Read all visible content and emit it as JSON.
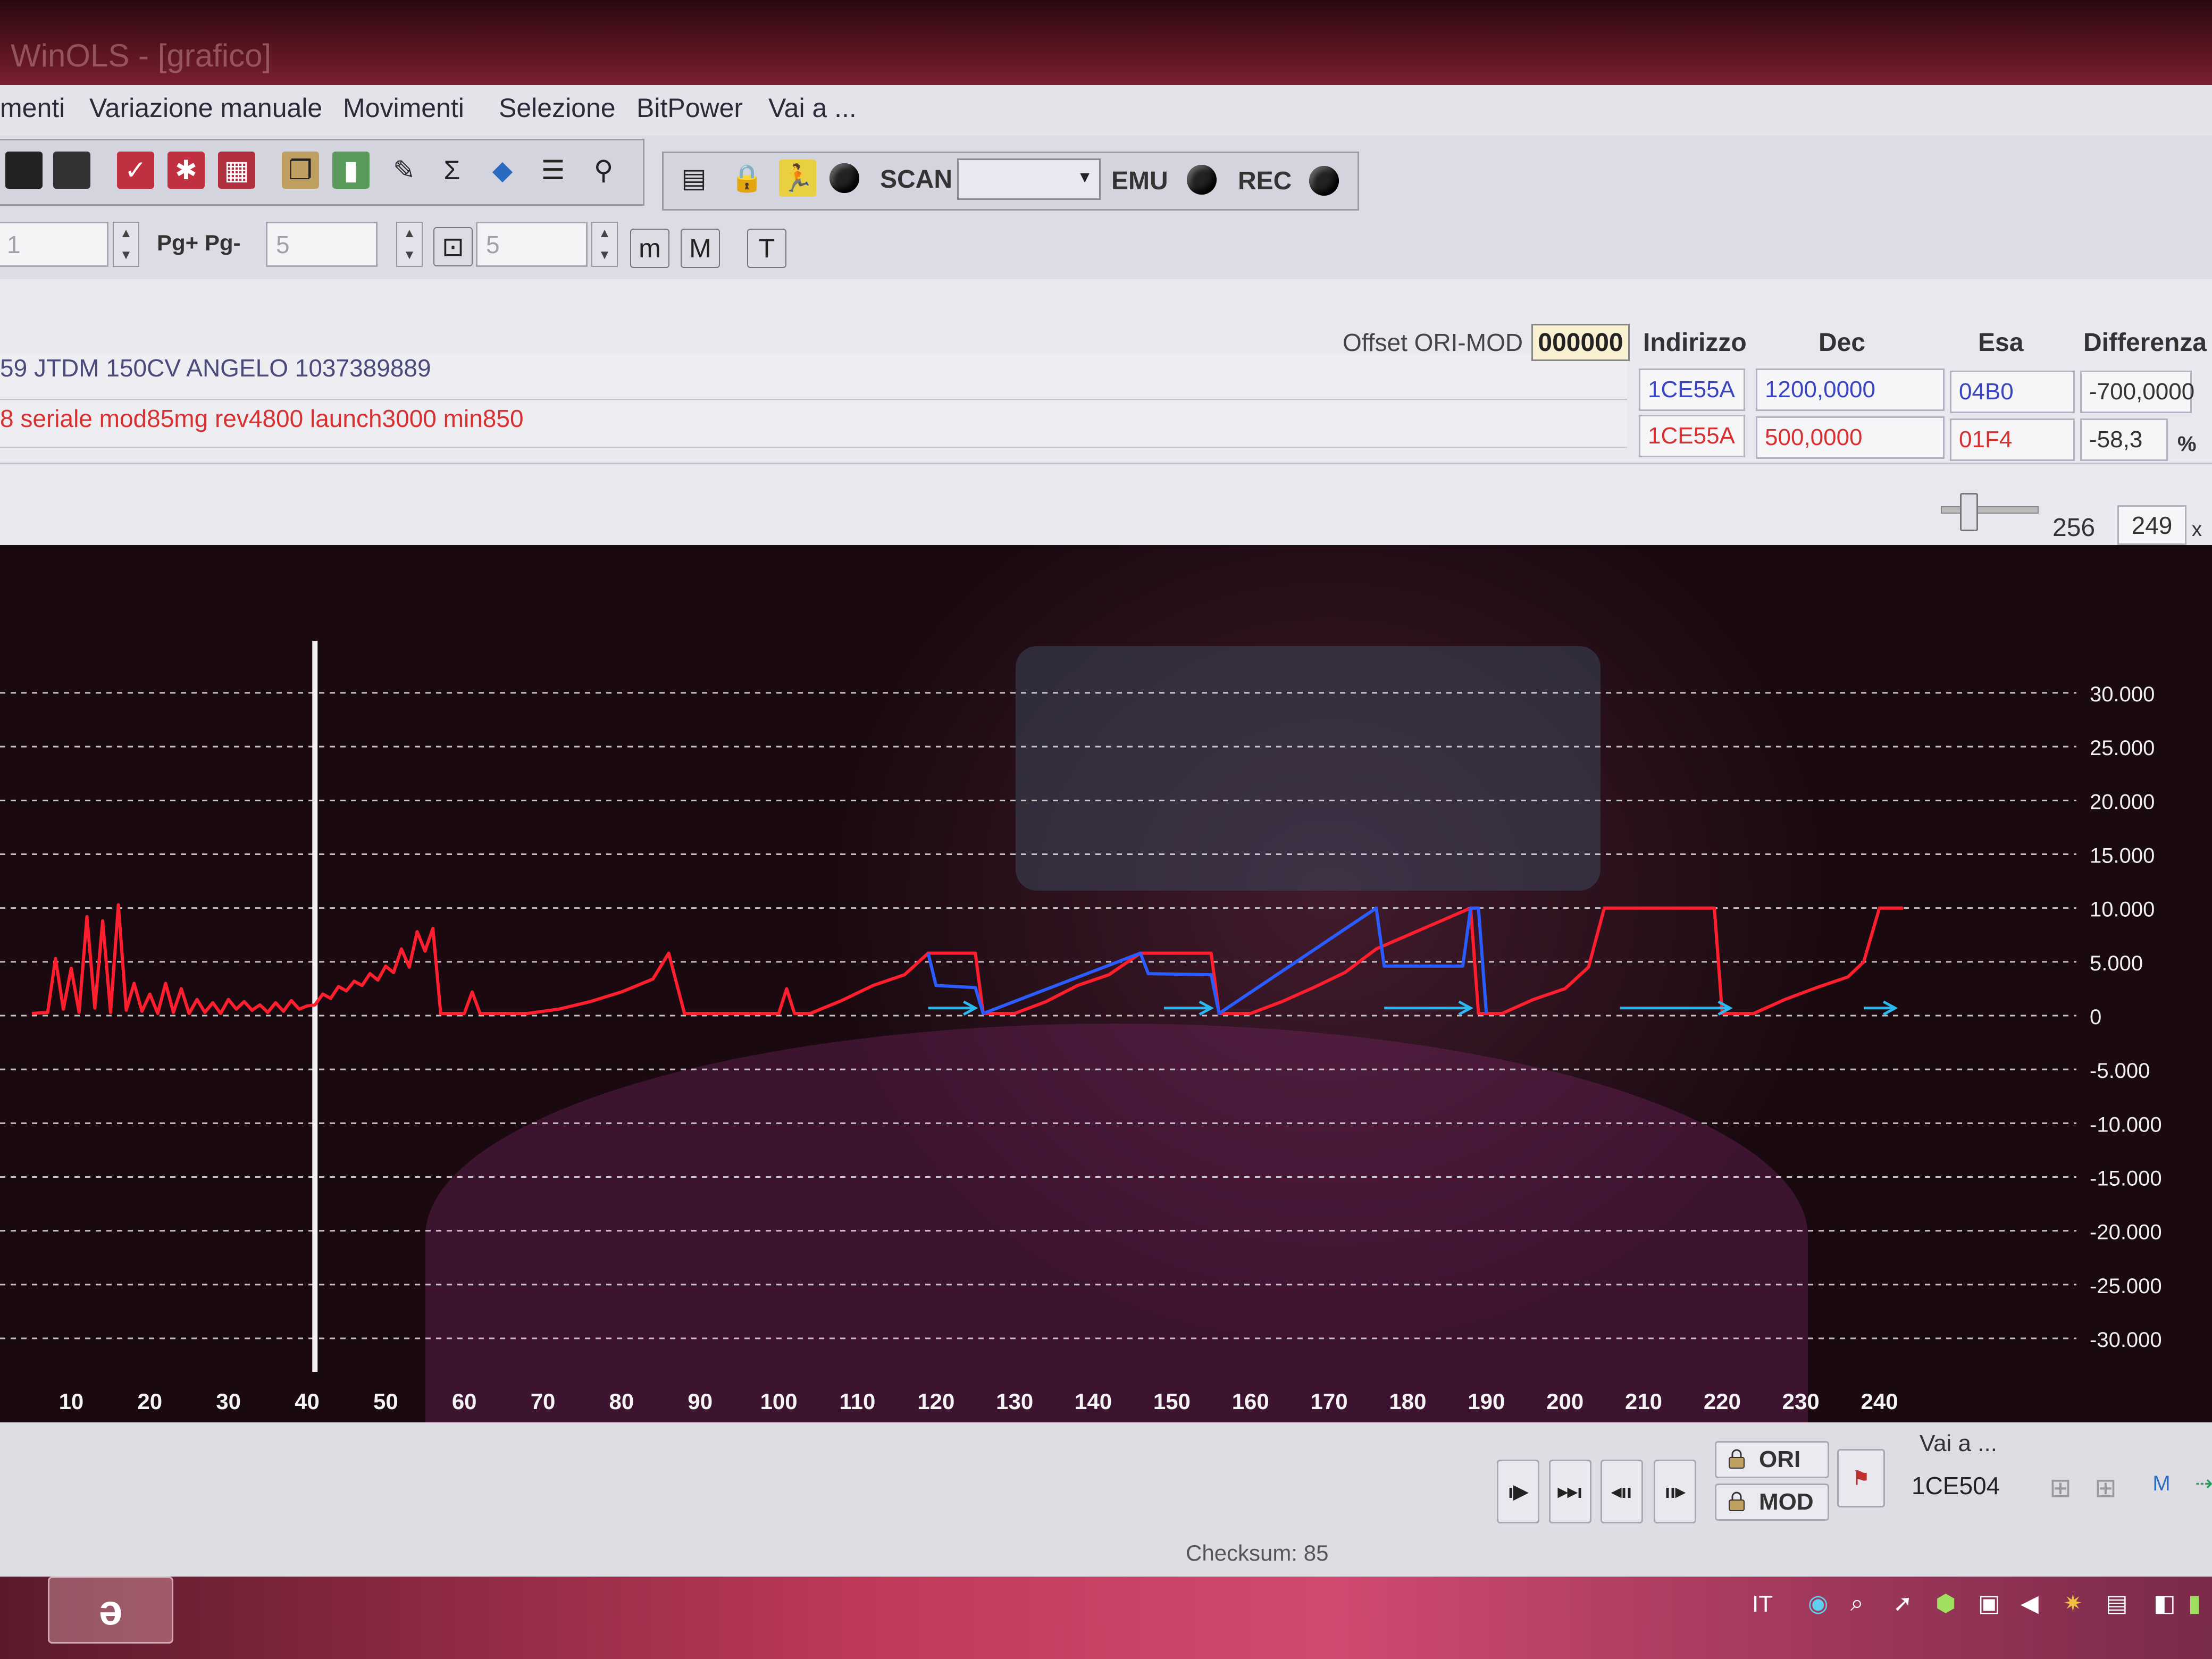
{
  "window": {
    "title": "WinOLS - [grafico]"
  },
  "menu": {
    "items": [
      "menti",
      "Variazione manuale",
      "Movimenti",
      "Selezione",
      "BitPower",
      "Vai a ..."
    ]
  },
  "toolbar": {
    "scan_label": "SCAN",
    "emu_label": "EMU",
    "rec_label": "REC",
    "scan_select_value": ""
  },
  "toolbar2": {
    "field1_value": "1",
    "pg_label": "Pg+ Pg-",
    "field2_value": "5",
    "field3_value": "5"
  },
  "info": {
    "ecu_name": "59 JTDM 150CV ANGELO 1037389889",
    "mod_name": "8 seriale mod85mg rev4800 launch3000 min850",
    "offset_label": "Offset ORI-MOD",
    "offset_value": "000000",
    "headers": {
      "indirizzo": "Indirizzo",
      "dec": "Dec",
      "esa": "Esa",
      "differenza": "Differenza"
    },
    "ori": {
      "indirizzo": "1CE55A",
      "dec": "1200,0000",
      "esa": "04B0",
      "differenza": "-700,0000"
    },
    "mod": {
      "indirizzo": "1CE55A",
      "dec": "500,0000",
      "esa": "01F4",
      "differenza": "-58,3",
      "unit": "%"
    },
    "slider_max": "256",
    "slider_value": "249",
    "slider_unit": "x"
  },
  "status": {
    "goto_label": "Vai a ...",
    "goto_value": "1CE504",
    "ori_label": "ORI",
    "mod_label": "MOD",
    "checksum": "Checksum: 85"
  },
  "taskbar": {
    "lang": "IT"
  },
  "colors": {
    "mod_series": "#ff1e2e",
    "ori_series": "#2a5cff",
    "arrow": "#2ab8f0",
    "grid": "#e0e0e0",
    "cursor": "#f0f0f0"
  },
  "chart_data": {
    "type": "line",
    "title": "",
    "xlabel": "",
    "ylabel": "",
    "xlim": [
      5,
      252
    ],
    "ylim": [
      -30000,
      30000
    ],
    "x_ticks": [
      10,
      20,
      30,
      40,
      50,
      60,
      70,
      80,
      90,
      100,
      110,
      120,
      130,
      140,
      150,
      160,
      170,
      180,
      190,
      200,
      210,
      220,
      230,
      240
    ],
    "y_ticks": [
      {
        "v": 30000,
        "label": "30.000"
      },
      {
        "v": 25000,
        "label": "25.000"
      },
      {
        "v": 20000,
        "label": "20.000"
      },
      {
        "v": 15000,
        "label": "15.000"
      },
      {
        "v": 10000,
        "label": "10.000"
      },
      {
        "v": 5000,
        "label": "5.000"
      },
      {
        "v": 0,
        "label": "0"
      },
      {
        "v": -5000,
        "label": "-5.000"
      },
      {
        "v": -10000,
        "label": "-10.000"
      },
      {
        "v": -15000,
        "label": "-15.000"
      },
      {
        "v": -20000,
        "label": "-20.000"
      },
      {
        "v": -25000,
        "label": "-25.000"
      },
      {
        "v": -30000,
        "label": "-30.000"
      }
    ],
    "grid": true,
    "cursor_x": 41,
    "series": [
      {
        "values": [
          [
            5,
            200
          ],
          [
            7,
            300
          ],
          [
            8,
            5300
          ],
          [
            9,
            600
          ],
          [
            10,
            4400
          ],
          [
            11,
            300
          ],
          [
            12,
            9200
          ],
          [
            13,
            700
          ],
          [
            14,
            8800
          ],
          [
            15,
            300
          ],
          [
            16,
            10300
          ],
          [
            17,
            500
          ],
          [
            18,
            3000
          ],
          [
            19,
            400
          ],
          [
            20,
            2000
          ],
          [
            21,
            200
          ],
          [
            22,
            3000
          ],
          [
            23,
            300
          ],
          [
            24,
            2500
          ],
          [
            25,
            200
          ],
          [
            26,
            1500
          ],
          [
            27,
            300
          ],
          [
            28,
            1200
          ],
          [
            29,
            200
          ],
          [
            30,
            1500
          ],
          [
            31,
            600
          ],
          [
            32,
            1300
          ],
          [
            33,
            500
          ],
          [
            34,
            1000
          ],
          [
            35,
            300
          ],
          [
            36,
            1200
          ],
          [
            37,
            400
          ],
          [
            38,
            1400
          ],
          [
            39,
            600
          ],
          [
            40,
            900
          ],
          [
            41,
            1000
          ],
          [
            42,
            2000
          ],
          [
            43,
            1600
          ],
          [
            44,
            2700
          ],
          [
            45,
            2300
          ],
          [
            46,
            3200
          ],
          [
            47,
            2800
          ],
          [
            48,
            3900
          ],
          [
            49,
            3300
          ],
          [
            50,
            4600
          ],
          [
            51,
            4000
          ],
          [
            52,
            6200
          ],
          [
            53,
            4500
          ],
          [
            54,
            7800
          ],
          [
            55,
            6000
          ],
          [
            56,
            8100
          ],
          [
            57,
            200
          ],
          [
            60,
            200
          ],
          [
            61,
            2200
          ],
          [
            62,
            200
          ],
          [
            64,
            200
          ],
          [
            68,
            200
          ],
          [
            72,
            600
          ],
          [
            76,
            1300
          ],
          [
            80,
            2200
          ],
          [
            84,
            3400
          ],
          [
            86,
            5800
          ],
          [
            88,
            200
          ],
          [
            100,
            200
          ],
          [
            101,
            2500
          ],
          [
            102,
            200
          ],
          [
            104,
            200
          ],
          [
            108,
            1400
          ],
          [
            112,
            2800
          ],
          [
            116,
            3800
          ],
          [
            119,
            5800
          ],
          [
            125,
            5800
          ],
          [
            126,
            200
          ],
          [
            130,
            200
          ],
          [
            134,
            1300
          ],
          [
            138,
            2800
          ],
          [
            142,
            3800
          ],
          [
            146,
            5800
          ],
          [
            155,
            5800
          ],
          [
            156,
            200
          ],
          [
            160,
            200
          ],
          [
            164,
            1300
          ],
          [
            168,
            2600
          ],
          [
            172,
            4000
          ],
          [
            176,
            6200
          ],
          [
            188,
            10000
          ],
          [
            189,
            200
          ],
          [
            192,
            200
          ],
          [
            196,
            1500
          ],
          [
            200,
            2500
          ],
          [
            203,
            4500
          ],
          [
            205,
            10000
          ],
          [
            219,
            10000
          ],
          [
            220,
            200
          ],
          [
            224,
            200
          ],
          [
            228,
            1500
          ],
          [
            232,
            2600
          ],
          [
            236,
            3600
          ],
          [
            238,
            5000
          ],
          [
            240,
            10000
          ],
          [
            243,
            10000
          ]
        ]
      },
      {
        "values": [
          [
            119,
            5800
          ],
          [
            120,
            2800
          ],
          [
            125,
            2600
          ],
          [
            126,
            200
          ],
          [
            146,
            5800
          ],
          [
            147,
            3900
          ],
          [
            155,
            3800
          ],
          [
            156,
            200
          ],
          [
            176,
            10000
          ],
          [
            177,
            4600
          ],
          [
            187,
            4600
          ],
          [
            188,
            10000
          ],
          [
            189,
            10000
          ],
          [
            190,
            200
          ]
        ]
      },
      {
        "values": [
          [
            119,
            700
          ],
          [
            125,
            700
          ]
        ]
      },
      {
        "values": [
          [
            149,
            700
          ],
          [
            155,
            700
          ]
        ]
      },
      {
        "values": [
          [
            177,
            700
          ],
          [
            188,
            700
          ]
        ]
      },
      {
        "values": [
          [
            207,
            700
          ],
          [
            221,
            700
          ]
        ]
      },
      {
        "values": [
          [
            238,
            700
          ],
          [
            242,
            700
          ]
        ]
      }
    ]
  }
}
